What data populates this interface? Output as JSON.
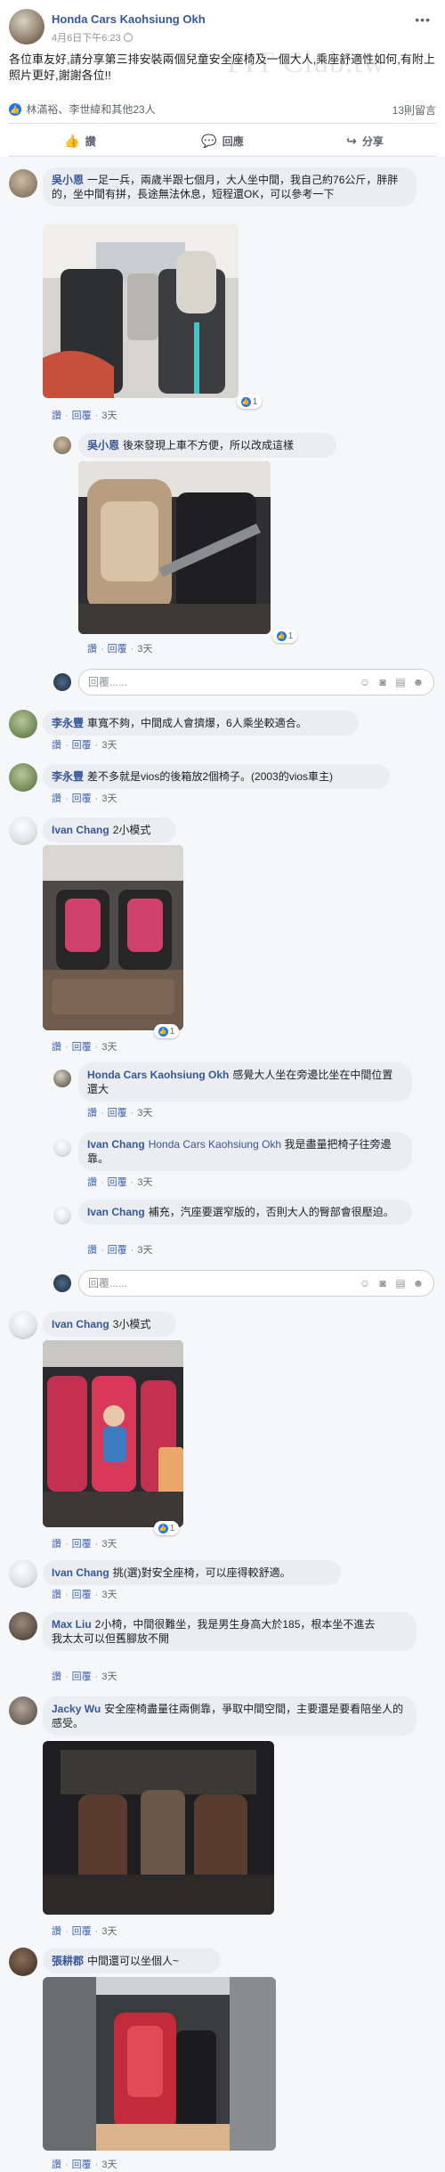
{
  "post": {
    "author": "Honda Cars Kaohsiung Okh",
    "time": "4月6日下午6:23",
    "text": "各位車友好,請分享第三排安裝兩個兒童安全座椅及一個大人,乘座舒適性如何,有附上照片更好,謝謝各位!!",
    "watermark": "FIT Club.tw",
    "reactions_text": "林滿裕、李世緯和其他23人",
    "comment_count": "13則留言",
    "actions": {
      "like": "讚",
      "comment": "回應",
      "share": "分享"
    },
    "icons": {
      "more": "more-icon",
      "globe": "globe-icon",
      "like": "thumbs-up-icon",
      "comment": "comment-icon",
      "share": "share-icon"
    }
  },
  "labels": {
    "like": "讚",
    "reply": "回覆",
    "time_3d": "3天"
  },
  "reply_placeholder": "回覆......",
  "comments": [
    {
      "name": "吳小恩",
      "text": "一足一兵，兩歲半跟七個月，大人坐中間，我自己約76公斤，胖胖的，坐中間有拼，長途無法休息，短程還OK，可以參考一下",
      "likes": "1"
    },
    {
      "name": "吳小恩",
      "text": "後來發現上車不方便，所以改成這樣",
      "likes": "1"
    },
    {
      "name": "李永豐",
      "text": "車寬不夠，中間成人會擠爆，6人乘坐較適合。"
    },
    {
      "name": "李永豐",
      "text": "差不多就是vios的後箱放2個椅子。(2003的vios車主)"
    },
    {
      "name": "Ivan Chang",
      "text": "2小模式",
      "likes": "1"
    },
    {
      "name": "Honda Cars Kaohsiung Okh",
      "text": "感覺大人坐在旁邊比坐在中間位置還大"
    },
    {
      "name": "Ivan Chang",
      "tag": "Honda Cars Kaohsiung Okh",
      "text": "我是盡量把椅子往旁邊靠。"
    },
    {
      "name": "Ivan Chang",
      "text": "補充，汽座要選窄版的，否則大人的臀部會很壓迫。"
    },
    {
      "name": "Ivan Chang",
      "text": "3小模式",
      "likes": "1"
    },
    {
      "name": "Ivan Chang",
      "text": "挑(選)對安全座椅，可以座得較舒適。"
    },
    {
      "name": "Max Liu",
      "text": "2小椅，中間很難坐，我是男生身高大於185，根本坐不進去",
      "text2": "我太太可以但舊腳放不開"
    },
    {
      "name": "Jacky Wu",
      "text": "安全座椅盡量往兩側靠，爭取中間空間，主要還是要看陪坐人的感受。"
    },
    {
      "name": "張耕郡",
      "text": "中間還可以坐個人~"
    }
  ],
  "colors": {
    "link": "#365899",
    "bubble": "#ebedf0",
    "like_blue": "#1877f2",
    "background": "#f6f7f9"
  }
}
